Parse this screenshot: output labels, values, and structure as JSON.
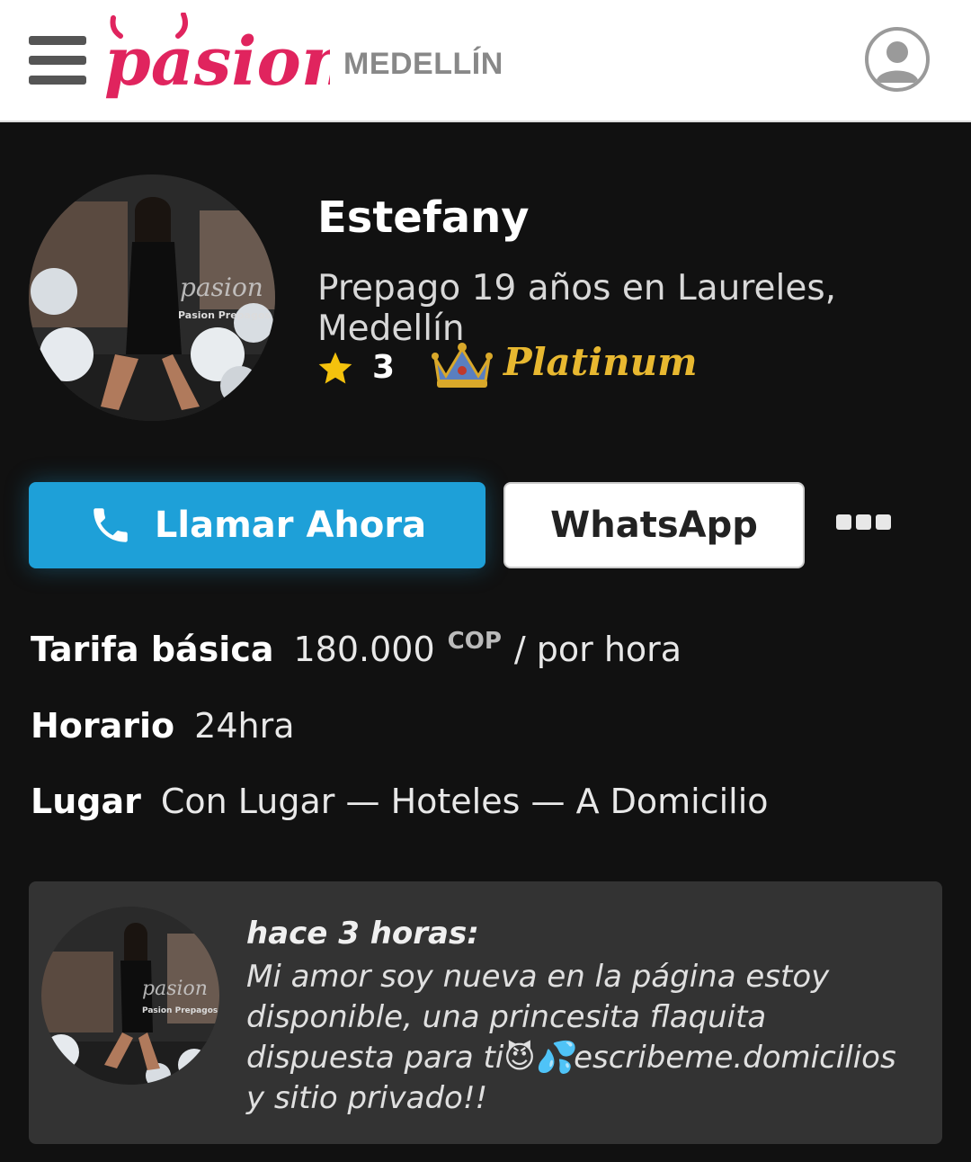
{
  "header": {
    "logo_text": "pasion",
    "city": "MEDELLÍN"
  },
  "profile": {
    "name": "Estefany",
    "subtitle": "Prepago 19 años en Laureles, Medellín",
    "rating": "3",
    "badge": "Platinum",
    "avatar_watermark": "pasion",
    "avatar_watermark_sub": "Pasion Prepagos"
  },
  "actions": {
    "call_label": "Llamar Ahora",
    "whatsapp_label": "WhatsApp"
  },
  "details": {
    "rate_label": "Tarifa básica",
    "rate_value": "180.000",
    "rate_currency": "COP",
    "rate_unit": "/ por hora",
    "schedule_label": "Horario",
    "schedule_value": "24hra",
    "place_label": "Lugar",
    "place_value": "Con Lugar — Hoteles — A Domicilio"
  },
  "post": {
    "time": "hace 3 horas:",
    "message": "Mi amor soy nueva en la página estoy disponible, una princesita flaquita dispuesta para ti😈💦escribeme.domicilios y sitio privado!!",
    "watermark": "pasion",
    "watermark_sub": "Pasion Prepagos"
  },
  "colors": {
    "brand": "#e0245e",
    "call": "#1ea0d8",
    "gold": "#e8b830",
    "background": "#111111",
    "card": "#333333"
  },
  "icons": [
    "menu-icon",
    "user-icon",
    "star-icon",
    "crown-icon",
    "phone-icon",
    "more-icon"
  ]
}
